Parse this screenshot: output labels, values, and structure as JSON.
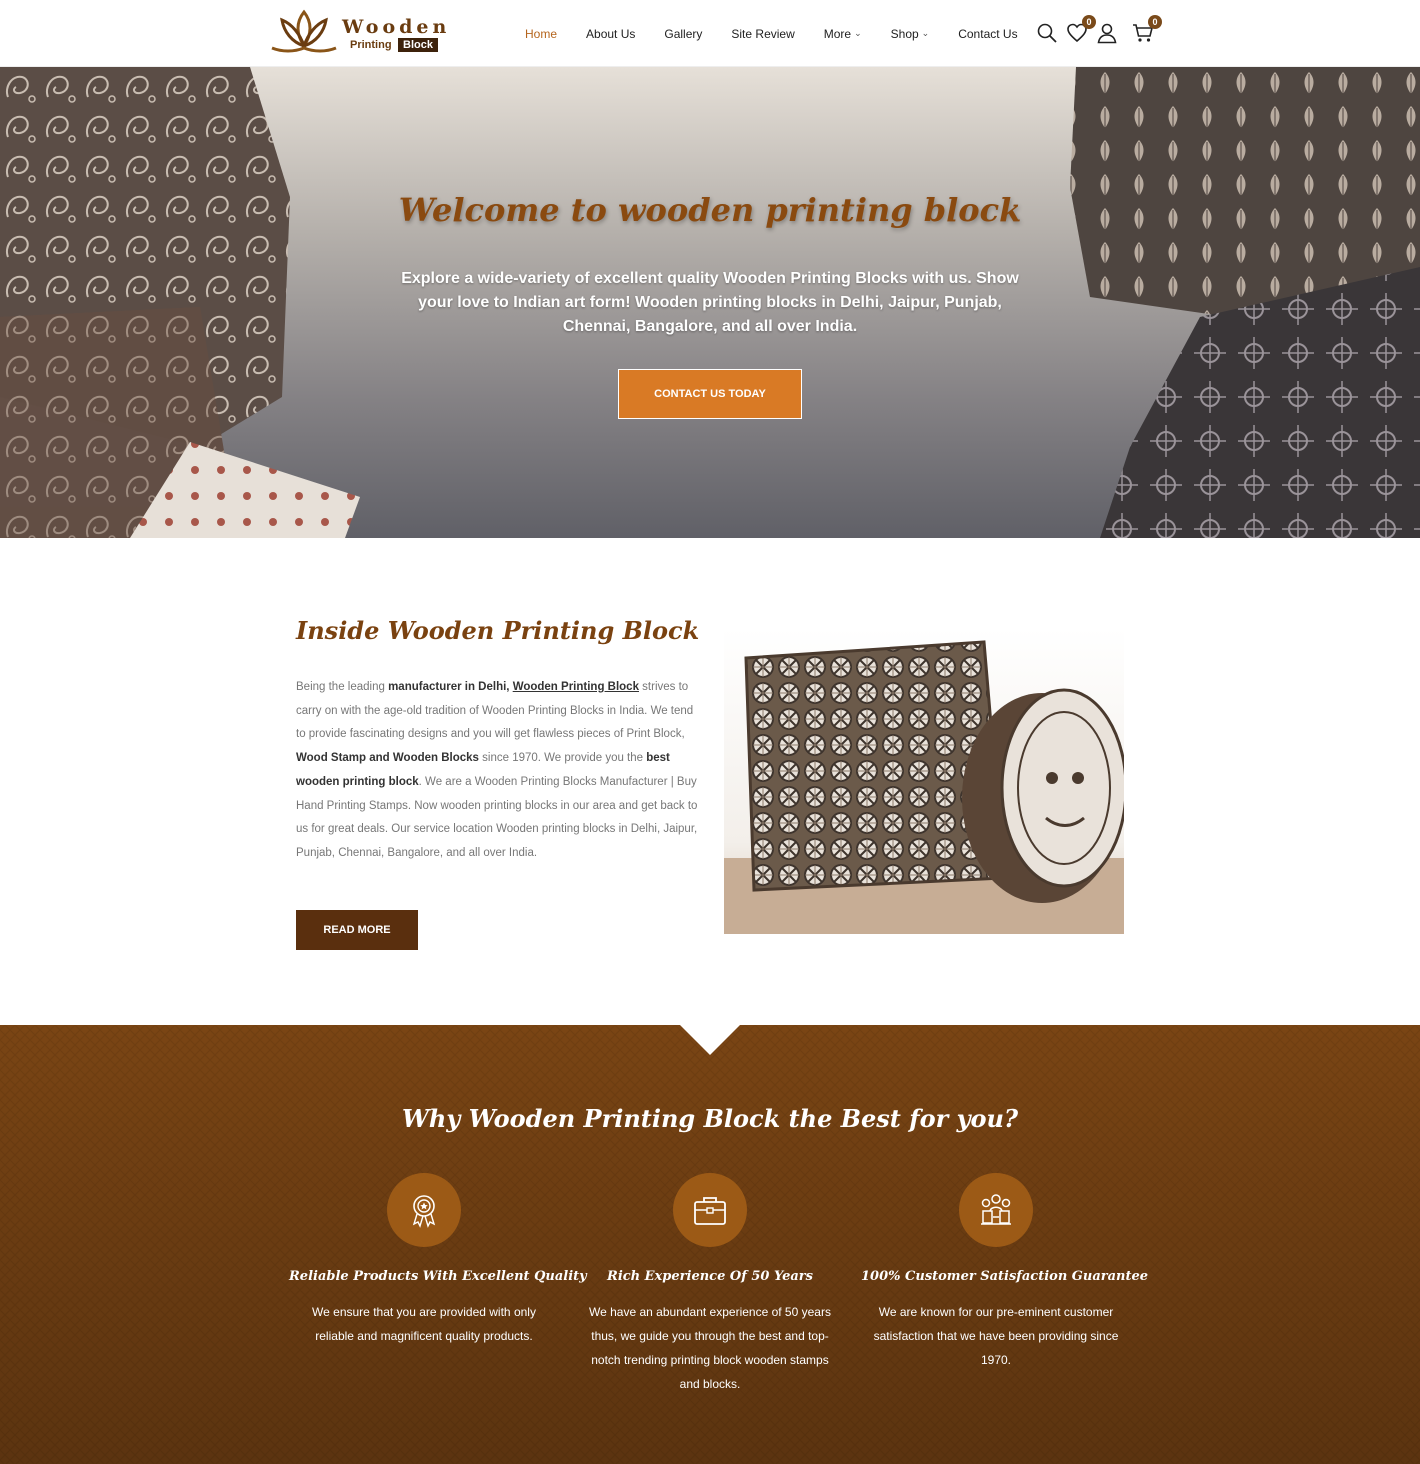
{
  "header": {
    "logo": {
      "word": "Wooden",
      "sub": "Printing",
      "sub_box": "Block"
    },
    "nav": [
      {
        "label": "Home",
        "active": true,
        "dropdown": false
      },
      {
        "label": "About Us",
        "active": false,
        "dropdown": false
      },
      {
        "label": "Gallery",
        "active": false,
        "dropdown": false
      },
      {
        "label": "Site Review",
        "active": false,
        "dropdown": false
      },
      {
        "label": "More",
        "active": false,
        "dropdown": true
      },
      {
        "label": "Shop",
        "active": false,
        "dropdown": true
      },
      {
        "label": "Contact Us",
        "active": false,
        "dropdown": false
      }
    ],
    "wishlist_count": "0",
    "cart_count": "0"
  },
  "hero": {
    "title": "Welcome to wooden printing block",
    "text": "Explore a wide-variety of excellent quality Wooden Printing Blocks with us. Show your love to Indian art form! Wooden printing blocks in Delhi, Jaipur, Punjab, Chennai, Bangalore, and all over India.",
    "button": "CONTACT US TODAY"
  },
  "about": {
    "title": "Inside Wooden Printing Block",
    "p1": "Being the leading ",
    "b1": "manufacturer in Delhi, ",
    "link1": "Wooden Printing Block",
    "p2": " strives to carry on with the age-old tradition of Wooden Printing Blocks in India. We tend to provide fascinating designs and you will get flawless pieces of Print Block, ",
    "b2": "Wood Stamp and Wooden Blocks",
    "p3": " since 1970. We provide you the ",
    "b3": "best wooden printing block",
    "p4": ". We are a Wooden Printing Blocks Manufacturer | Buy Hand Printing Stamps. Now wooden printing blocks in our area and get back to us for great deals. Our service location Wooden printing blocks in Delhi, Jaipur, Punjab, Chennai, Bangalore, and all over India.",
    "button": "READ MORE"
  },
  "why": {
    "title": "Why Wooden Printing Block the Best for you?",
    "features": [
      {
        "icon": "award-badge-icon",
        "title": "Reliable Products With Excellent Quality",
        "text": "We ensure that you are provided with only reliable and magnificent quality products."
      },
      {
        "icon": "briefcase-icon",
        "title": "Rich Experience Of 50 Years",
        "text": "We have an abundant experience of 50 years thus, we guide you through the best and top-notch trending printing block wooden stamps and blocks."
      },
      {
        "icon": "customer-group-icon",
        "title": "100% Customer Satisfaction Guarantee",
        "text": "We are known for our pre-eminent customer satisfaction that we have been providing since 1970."
      }
    ]
  },
  "colors": {
    "accent": "#b5651d",
    "brown_dark": "#5a2f0e",
    "hero_button": "#d97a25",
    "why_bg": "#6a3c12"
  }
}
